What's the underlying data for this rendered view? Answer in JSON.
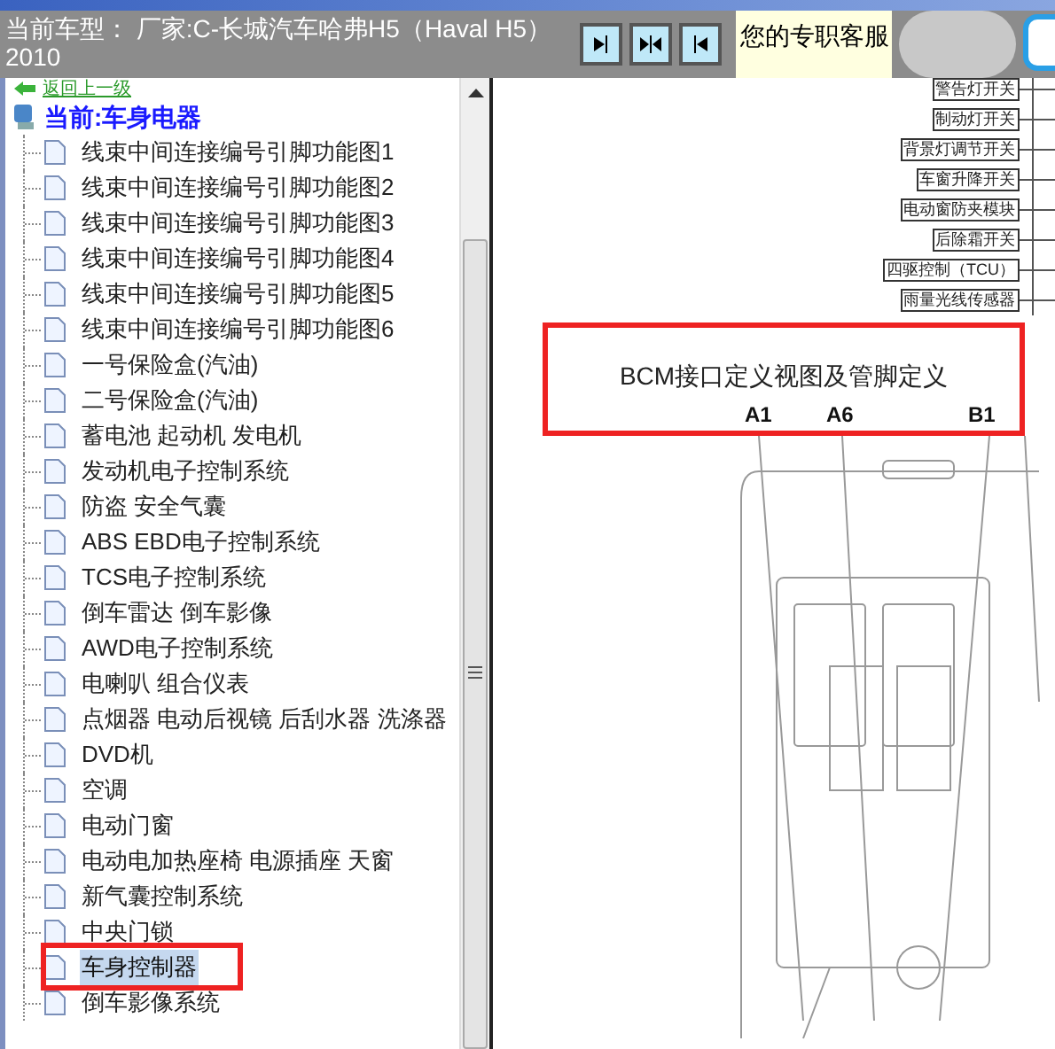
{
  "header": {
    "vehicle_label": "当前车型：",
    "vehicle_value": "厂家:C-长城汽车哈弗H5（Haval H5）2010",
    "toolbar_buttons": [
      {
        "kind": "right"
      },
      {
        "kind": "both"
      },
      {
        "kind": "left"
      }
    ],
    "service_text": "您的专职客服"
  },
  "tree": {
    "back_link": "返回上一级",
    "root": {
      "label": "当前:车身电器",
      "children": [
        {
          "label": "线束中间连接编号引脚功能图1",
          "selected": false,
          "callout": false
        },
        {
          "label": "线束中间连接编号引脚功能图2",
          "selected": false,
          "callout": false
        },
        {
          "label": "线束中间连接编号引脚功能图3",
          "selected": false,
          "callout": false
        },
        {
          "label": "线束中间连接编号引脚功能图4",
          "selected": false,
          "callout": false
        },
        {
          "label": "线束中间连接编号引脚功能图5",
          "selected": false,
          "callout": false
        },
        {
          "label": "线束中间连接编号引脚功能图6",
          "selected": false,
          "callout": false
        },
        {
          "label": "一号保险盒(汽油)",
          "selected": false,
          "callout": false
        },
        {
          "label": "二号保险盒(汽油)",
          "selected": false,
          "callout": false
        },
        {
          "label": "蓄电池 起动机 发电机",
          "selected": false,
          "callout": false
        },
        {
          "label": "发动机电子控制系统",
          "selected": false,
          "callout": false
        },
        {
          "label": "防盗 安全气囊",
          "selected": false,
          "callout": false
        },
        {
          "label": "ABS EBD电子控制系统",
          "selected": false,
          "callout": false
        },
        {
          "label": "TCS电子控制系统",
          "selected": false,
          "callout": false
        },
        {
          "label": "倒车雷达 倒车影像",
          "selected": false,
          "callout": false
        },
        {
          "label": "AWD电子控制系统",
          "selected": false,
          "callout": false
        },
        {
          "label": "电喇叭 组合仪表",
          "selected": false,
          "callout": false
        },
        {
          "label": "点烟器 电动后视镜 后刮水器 洗涤器",
          "selected": false,
          "callout": false
        },
        {
          "label": "DVD机",
          "selected": false,
          "callout": false
        },
        {
          "label": "空调",
          "selected": false,
          "callout": false
        },
        {
          "label": "电动门窗",
          "selected": false,
          "callout": false
        },
        {
          "label": "电动电加热座椅 电源插座 天窗",
          "selected": false,
          "callout": false
        },
        {
          "label": "新气囊控制系统",
          "selected": false,
          "callout": false
        },
        {
          "label": "中央门锁",
          "selected": false,
          "callout": false
        },
        {
          "label": "车身控制器",
          "selected": true,
          "callout": true
        },
        {
          "label": "倒车影像系统",
          "selected": false,
          "callout": false
        }
      ]
    }
  },
  "diagram": {
    "component_labels": [
      "警告灯开关",
      "制动灯开关",
      "背景灯调节开关",
      "车窗升降开关",
      "电动窗防夹模块",
      "后除霜开关",
      "四驱控制（TCU）",
      "雨量光线传感器"
    ],
    "title": "BCM接口定义视图及管脚定义",
    "title_callout": true,
    "pin_labels": [
      "A1",
      "A6",
      "B1"
    ]
  }
}
